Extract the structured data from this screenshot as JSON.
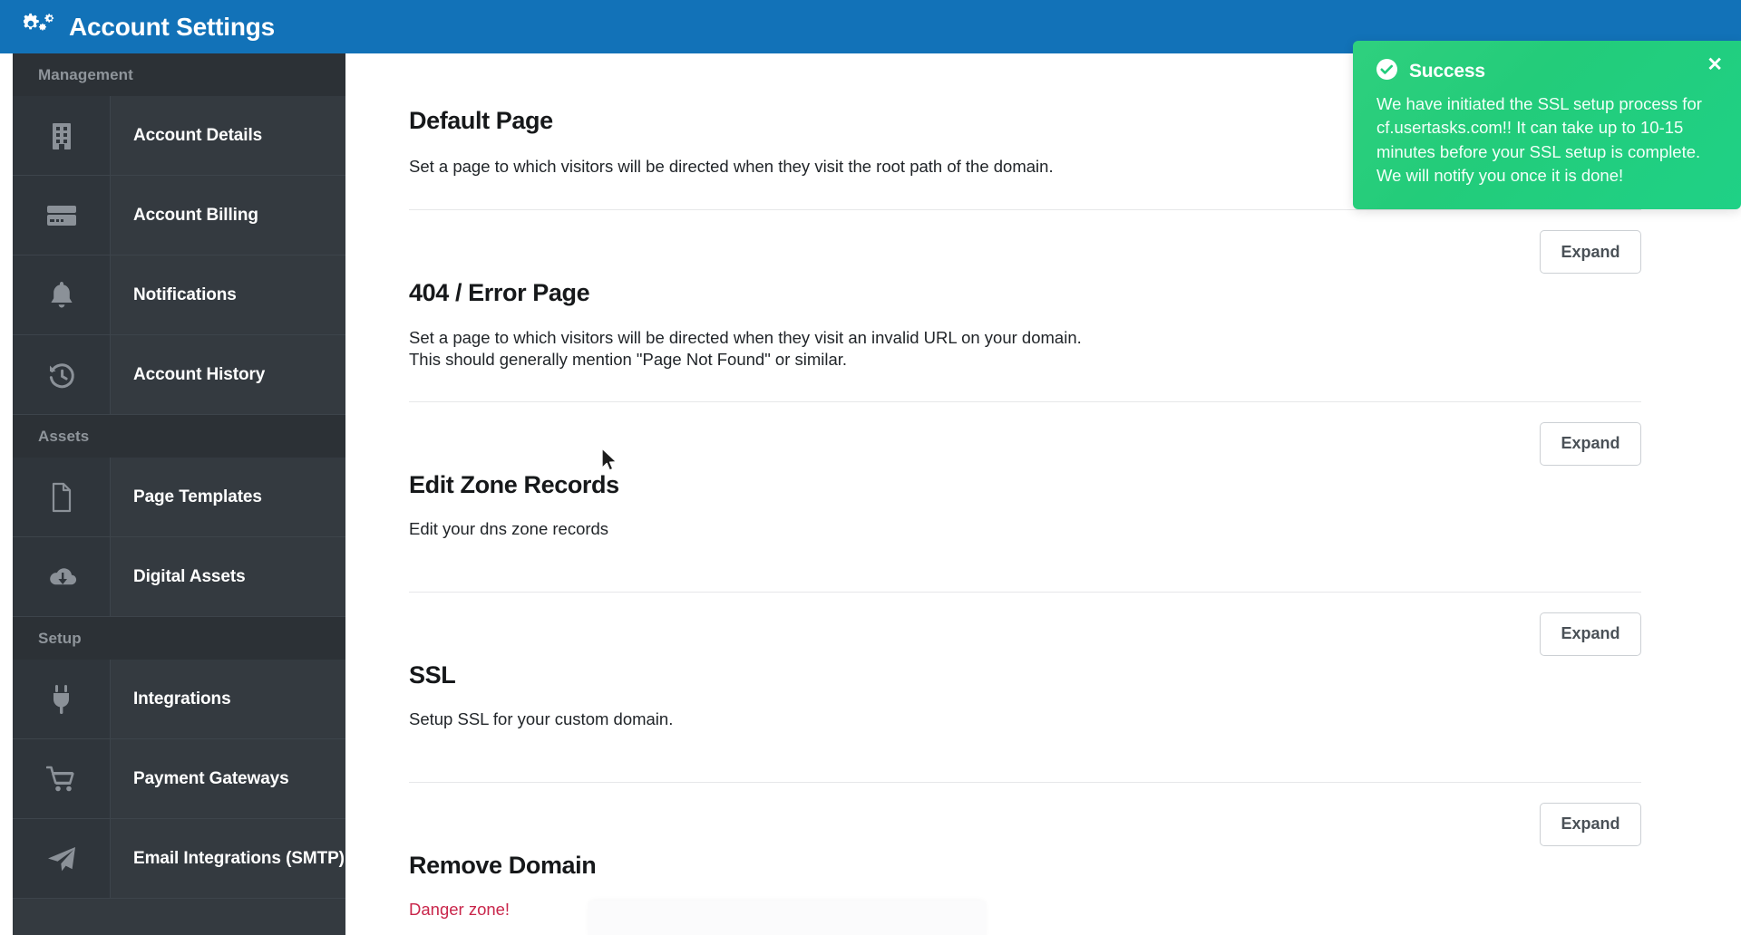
{
  "header": {
    "title": "Account Settings",
    "icon": "gears-icon",
    "bg_color": "#1272b8"
  },
  "sidebar": {
    "bg_color": "#343a40",
    "groups": [
      {
        "label": "Management",
        "items": [
          {
            "label": "Account Details",
            "icon": "building-icon"
          },
          {
            "label": "Account Billing",
            "icon": "credit-card-icon"
          },
          {
            "label": "Notifications",
            "icon": "bell-icon"
          },
          {
            "label": "Account History",
            "icon": "history-clock-icon"
          }
        ]
      },
      {
        "label": "Assets",
        "items": [
          {
            "label": "Page Templates",
            "icon": "file-icon"
          },
          {
            "label": "Digital Assets",
            "icon": "cloud-download-icon"
          }
        ]
      },
      {
        "label": "Setup",
        "items": [
          {
            "label": "Integrations",
            "icon": "plug-icon"
          },
          {
            "label": "Payment Gateways",
            "icon": "shopping-cart-icon"
          },
          {
            "label": "Email Integrations (SMTP)",
            "icon": "paper-plane-icon"
          }
        ]
      }
    ]
  },
  "main": {
    "sections": [
      {
        "title": "Default Page",
        "desc_lines": [
          "Set a page to which visitors will be directed when they visit the root path of the domain."
        ],
        "has_expand": false,
        "expand_label": "",
        "danger": false
      },
      {
        "title": "404 / Error Page",
        "desc_lines": [
          "Set a page to which visitors will be directed when they visit an invalid URL on your domain.",
          "This should generally mention \"Page Not Found\" or similar."
        ],
        "has_expand": true,
        "expand_label": "Expand",
        "danger": false
      },
      {
        "title": "Edit Zone Records",
        "desc_lines": [
          "Edit your dns zone records"
        ],
        "has_expand": true,
        "expand_label": "Expand",
        "danger": false
      },
      {
        "title": "SSL",
        "desc_lines": [
          "Setup SSL for your custom domain."
        ],
        "has_expand": true,
        "expand_label": "Expand",
        "danger": false
      },
      {
        "title": "Remove Domain",
        "desc_lines": [
          "Danger zone!"
        ],
        "has_expand": true,
        "expand_label": "Expand",
        "danger": true
      }
    ],
    "danger_color": "#c9264b"
  },
  "toast": {
    "type": "success",
    "icon": "check-circle-icon",
    "title": "Success",
    "message": "We have initiated the SSL setup process for cf.usertasks.com!! It can take up to 10-15 minutes before your SSL setup is complete. We will notify you once it is done!",
    "close_label": "✕",
    "bg_color": "#22cc7c"
  }
}
